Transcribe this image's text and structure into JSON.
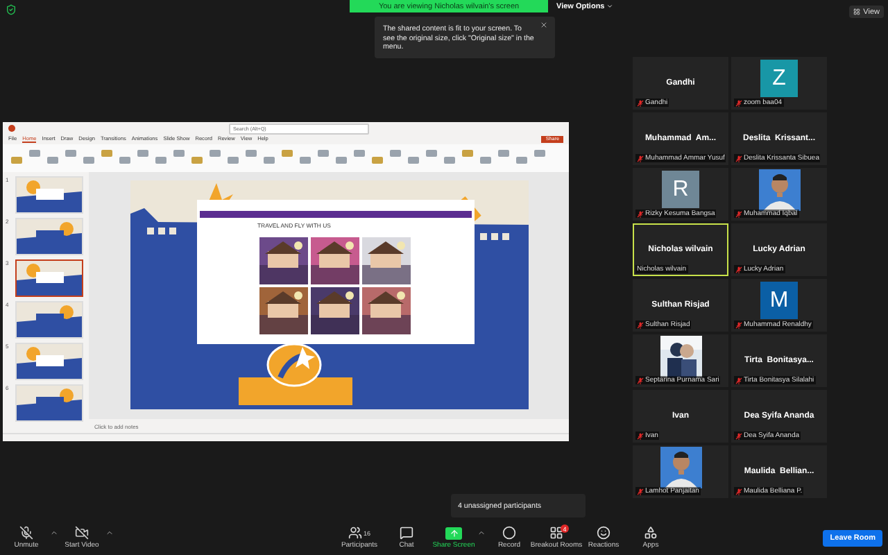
{
  "banner": {
    "text": "You are viewing Nicholas wilvain's screen"
  },
  "view_options": {
    "label": "View Options"
  },
  "fit_tooltip": {
    "text": "The shared content is fit to your screen. To see the original size, click \"Original size\" in the menu."
  },
  "view_button": {
    "label": "View"
  },
  "shared_screen": {
    "search": {
      "placeholder": "Search (Alt+Q)"
    },
    "share_button": "Share",
    "ribbon_tabs": [
      {
        "label": "File",
        "selected": false
      },
      {
        "label": "Home",
        "selected": true
      },
      {
        "label": "Insert",
        "selected": false
      },
      {
        "label": "Draw",
        "selected": false
      },
      {
        "label": "Design",
        "selected": false
      },
      {
        "label": "Transitions",
        "selected": false
      },
      {
        "label": "Animations",
        "selected": false
      },
      {
        "label": "Slide Show",
        "selected": false
      },
      {
        "label": "Record",
        "selected": false
      },
      {
        "label": "Review",
        "selected": false
      },
      {
        "label": "View",
        "selected": false
      },
      {
        "label": "Help",
        "selected": false
      }
    ],
    "thumbnails": [
      {
        "number": "1",
        "selected": false
      },
      {
        "number": "2",
        "selected": false
      },
      {
        "number": "3",
        "selected": true
      },
      {
        "number": "4",
        "selected": false
      },
      {
        "number": "5",
        "selected": false
      },
      {
        "number": "6",
        "selected": false
      }
    ],
    "slide_heading": "TRAVEL AND FLY WITH US",
    "notes_placeholder": "Click to add notes"
  },
  "participants": [
    {
      "kind": "name",
      "heading": "Gandhi",
      "label": "Gandhi",
      "muted": true,
      "active": false
    },
    {
      "kind": "letter",
      "letter": "Z",
      "color": "#1897a6",
      "label": "zoom baa04",
      "muted": true,
      "active": false
    },
    {
      "kind": "name",
      "heading": "Muhammad  Am...",
      "label": "Muhammad Ammar Yusuf",
      "muted": true,
      "active": false
    },
    {
      "kind": "name",
      "heading": "Deslita  Krissant...",
      "label": "Deslita Krissanta Sibuea",
      "muted": true,
      "active": false
    },
    {
      "kind": "letter",
      "letter": "R",
      "color": "#6f8796",
      "label": "Rizky Kesuma Bangsa",
      "muted": true,
      "active": false
    },
    {
      "label": "Muhammad Iqbal",
      "muted": true,
      "active": false
    },
    {
      "kind": "name",
      "heading": "Nicholas wilvain",
      "label": "Nicholas wilvain",
      "muted": false,
      "active": true
    },
    {
      "kind": "name",
      "heading": "Lucky Adrian",
      "label": "Lucky Adrian",
      "muted": true,
      "active": false
    },
    {
      "kind": "name",
      "heading": "Sulthan Risjad",
      "label": "Sulthan Risjad",
      "muted": true,
      "active": false
    },
    {
      "kind": "letter",
      "letter": "M",
      "color": "#0b5fa5",
      "label": "Muhammad Renaldhy",
      "muted": true,
      "active": false
    },
    {
      "label": "Septarina Purnama Sari",
      "muted": true,
      "active": false
    },
    {
      "kind": "name",
      "heading": "Tirta  Bonitasya...",
      "label": "Tirta Bonitasya Silalahi",
      "muted": true,
      "active": false
    },
    {
      "kind": "name",
      "heading": "Ivan",
      "label": "Ivan",
      "muted": true,
      "active": false
    },
    {
      "kind": "name",
      "heading": "Dea Syifa Ananda",
      "label": "Dea Syifa Ananda",
      "muted": true,
      "active": false
    },
    {
      "label": "Lamhot Panjaitan",
      "muted": true,
      "active": false
    },
    {
      "kind": "name",
      "heading": "Maulida  Bellian...",
      "label": "Maulida Belliana P.",
      "muted": true,
      "active": false
    }
  ],
  "unassigned_tooltip": {
    "text": "4 unassigned participants"
  },
  "toolbar": [
    {
      "kind": "mic",
      "label": "Unmute",
      "caret": true
    },
    {
      "kind": "video",
      "label": "Start Video",
      "caret": true
    },
    {
      "kind": "participants",
      "label": "Participants",
      "count": "16"
    },
    {
      "kind": "chat",
      "label": "Chat"
    },
    {
      "kind": "share",
      "label": "Share Screen",
      "caret": true
    },
    {
      "kind": "record",
      "label": "Record"
    },
    {
      "kind": "breakout",
      "label": "Breakout Rooms",
      "badge": "4"
    },
    {
      "kind": "reactions",
      "label": "Reactions"
    },
    {
      "kind": "apps",
      "label": "Apps"
    }
  ],
  "leave_button": {
    "label": "Leave Room"
  }
}
